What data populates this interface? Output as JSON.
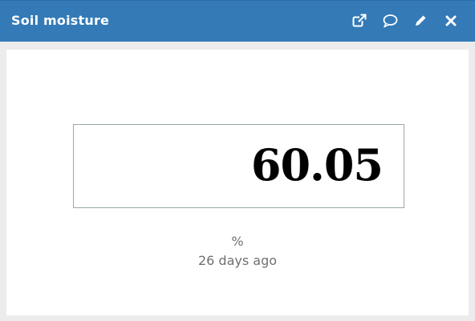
{
  "widget": {
    "title": "Soil moisture",
    "value": "60.05",
    "unit": "%",
    "updated": "26 days ago",
    "toolbar": {
      "icons": [
        "external-link-icon",
        "comment-icon",
        "pencil-icon",
        "close-icon"
      ]
    }
  },
  "colors": {
    "header_bg": "#337ab7",
    "header_text": "#ffffff",
    "value_border": "#9aa8a4",
    "meta_text": "#707070"
  }
}
